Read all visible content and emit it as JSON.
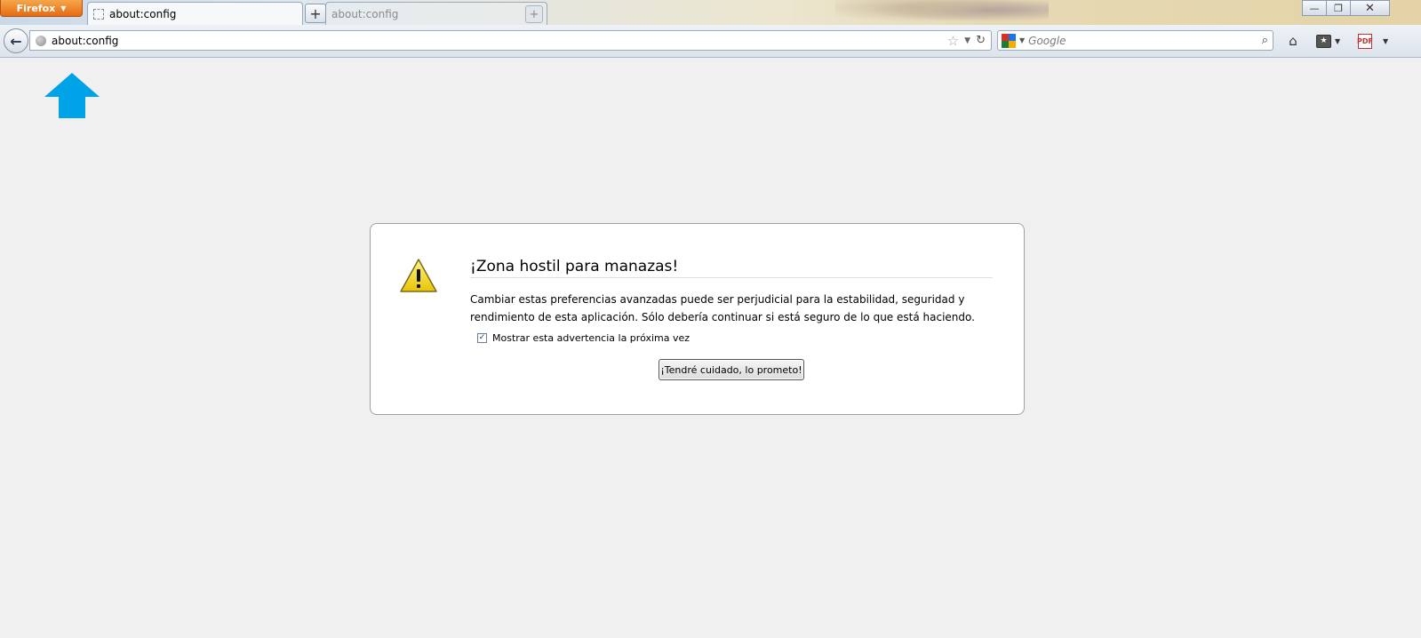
{
  "browser": {
    "menu_button_label": "Firefox",
    "tabs": [
      {
        "title": "about:config",
        "active": true
      },
      {
        "title": "about:config",
        "active": false
      }
    ],
    "new_tab_symbol": "+",
    "window_controls": {
      "minimize": "—",
      "restore": "❐",
      "close": "✕"
    }
  },
  "navbar": {
    "url": "about:config",
    "search_placeholder": "Google"
  },
  "warning": {
    "title": "¡Zona hostil para manazas!",
    "line1": "Cambiar estas preferencias avanzadas puede ser perjudicial para la estabilidad, seguridad y",
    "line2": "rendimiento de esta aplicación. Sólo debería continuar si está seguro de lo que está haciendo.",
    "checkbox_label": "Mostrar esta advertencia la próxima vez",
    "checkbox_checked": true,
    "button_label": "¡Tendré cuidado, lo prometo!"
  },
  "colors": {
    "annotation_arrow": "#00a2e8",
    "firefox_button": "#e56b13",
    "warning_icon": "#f5d60a"
  },
  "icons": [
    "back-arrow-icon",
    "globe-icon",
    "star-icon",
    "reload-icon",
    "google-icon",
    "search-icon",
    "home-icon",
    "bookmarks-icon",
    "pdf-icon",
    "warning-icon"
  ]
}
